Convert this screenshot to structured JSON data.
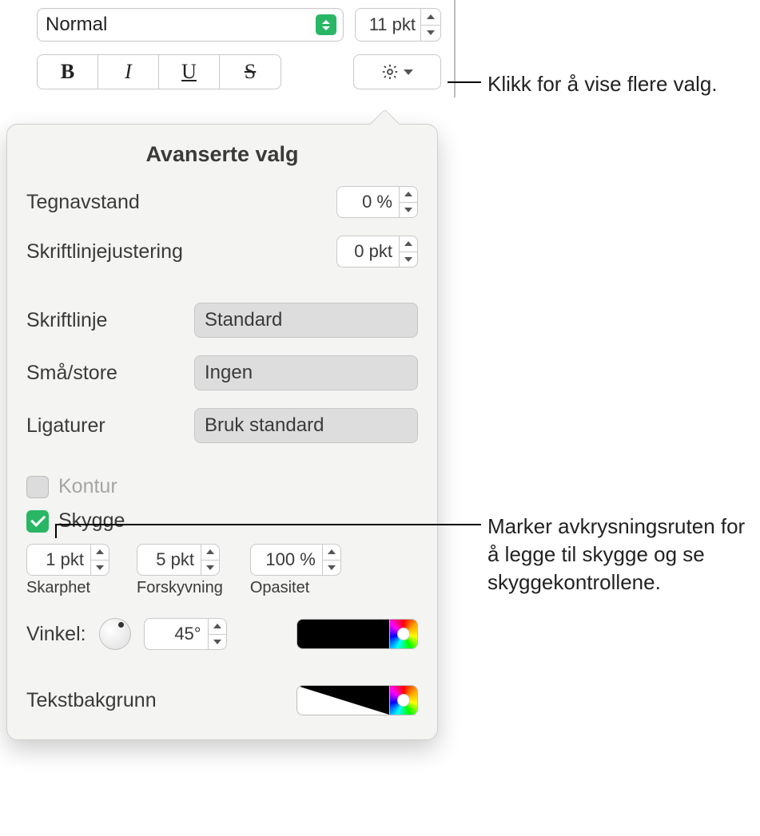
{
  "toolbar": {
    "font_style": "Normal",
    "font_size": "11 pkt",
    "B": "B",
    "I": "I",
    "U": "U",
    "S": "S"
  },
  "popover": {
    "title": "Avanserte valg",
    "tracking_label": "Tegnavstand",
    "tracking_value": "0 %",
    "baseline_label": "Skriftlinjejustering",
    "baseline_value": "0 pkt",
    "baseline_style_label": "Skriftlinje",
    "baseline_style_value": "Standard",
    "caps_label": "Små/store",
    "caps_value": "Ingen",
    "ligatures_label": "Ligaturer",
    "ligatures_value": "Bruk standard",
    "outline_label": "Kontur",
    "shadow_label": "Skygge",
    "blur_value": "1 pkt",
    "blur_caption": "Skarphet",
    "offset_value": "5 pkt",
    "offset_caption": "Forskyvning",
    "opacity_value": "100 %",
    "opacity_caption": "Opasitet",
    "angle_label": "Vinkel:",
    "angle_value": "45°",
    "textbg_label": "Tekstbakgrunn"
  },
  "callouts": {
    "gear": "Klikk for å vise flere valg.",
    "shadow": "Marker avkrysningsruten for å legge til skygge og se skyggekontrollene."
  }
}
